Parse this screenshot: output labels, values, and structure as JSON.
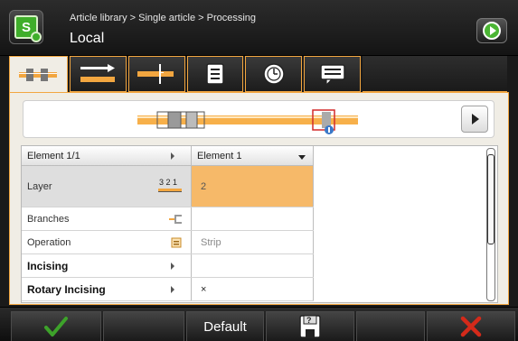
{
  "header": {
    "breadcrumb": "Article library > Single article > Processing",
    "location": "Local"
  },
  "tabs": [
    {
      "icon": "article-overview-icon",
      "active": true
    },
    {
      "icon": "feed-arrow-icon",
      "active": false
    },
    {
      "icon": "cut-marker-icon",
      "active": false
    },
    {
      "icon": "document-list-icon",
      "active": false
    },
    {
      "icon": "clock-icon",
      "active": false
    },
    {
      "icon": "message-icon",
      "active": false
    }
  ],
  "grid": {
    "col1_header": "Element 1/1",
    "col2_header": "Element 1",
    "rows": [
      {
        "label": "Layer",
        "icon": "layer-scale-icon",
        "icon_text": "3 2 1",
        "value": "2"
      },
      {
        "label": "Branches",
        "icon": "branches-icon",
        "value": ""
      },
      {
        "label": "Operation",
        "icon": "operation-icon",
        "value": "Strip"
      },
      {
        "label": "Incising",
        "value": ""
      },
      {
        "label": "Rotary Incising",
        "value": "×"
      }
    ]
  },
  "footer": {
    "confirm_icon": "checkmark-icon",
    "default_label": "Default",
    "save_icon": "save-question-icon",
    "cancel_icon": "close-icon"
  },
  "colors": {
    "accent_orange": "#f2a640",
    "selected_cell": "#f6b969",
    "confirm_green": "#3da22a",
    "cancel_red": "#d42a1a"
  }
}
